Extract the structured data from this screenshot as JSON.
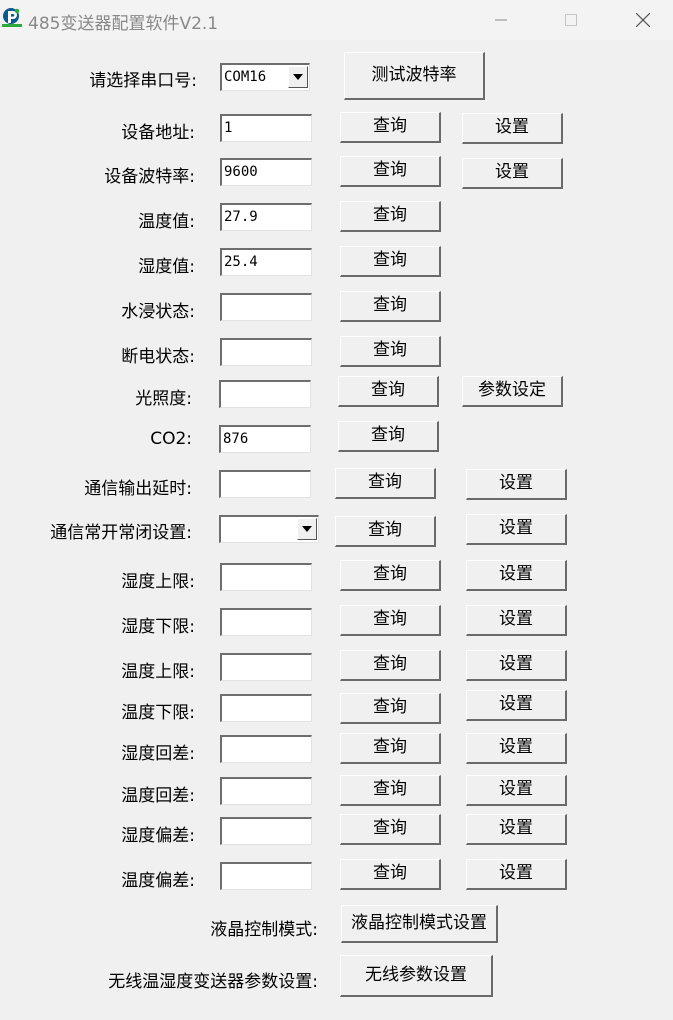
{
  "window": {
    "title": "485变送器配置软件V2.1",
    "icon": "app-logo-icon",
    "controls": [
      "minimize-icon",
      "maximize-icon",
      "close-icon"
    ]
  },
  "port": {
    "label": "请选择串口号:",
    "value": "COM16",
    "test_button": "测试波特率"
  },
  "rows": [
    {
      "label": "设备地址:",
      "value": "1",
      "query": "查询",
      "set": "设置"
    },
    {
      "label": "设备波特率:",
      "value": "9600",
      "query": "查询",
      "set": "设置"
    },
    {
      "label": "温度值:",
      "value": "27.9",
      "query": "查询"
    },
    {
      "label": "湿度值:",
      "value": "25.4",
      "query": "查询"
    },
    {
      "label": "水浸状态:",
      "value": "",
      "query": "查询"
    },
    {
      "label": "断电状态:",
      "value": "",
      "query": "查询"
    },
    {
      "label": "光照度:",
      "value": "",
      "query": "查询",
      "set": "参数设定"
    },
    {
      "label": "CO2:",
      "value": "876",
      "query": "查询"
    },
    {
      "label": "通信输出延时:",
      "value": "",
      "query": "查询",
      "set": "设置"
    },
    {
      "label": "通信常开常闭设置:",
      "value": "",
      "query": "查询",
      "set": "设置"
    },
    {
      "label": "湿度上限:",
      "value": "",
      "query": "查询",
      "set": "设置"
    },
    {
      "label": "湿度下限:",
      "value": "",
      "query": "查询",
      "set": "设置"
    },
    {
      "label": "温度上限:",
      "value": "",
      "query": "查询",
      "set": "设置"
    },
    {
      "label": "温度下限:",
      "value": "",
      "query": "查询",
      "set": "设置"
    },
    {
      "label": "湿度回差:",
      "value": "",
      "query": "查询",
      "set": "设置"
    },
    {
      "label": "温度回差:",
      "value": "",
      "query": "查询",
      "set": "设置"
    },
    {
      "label": "湿度偏差:",
      "value": "",
      "query": "查询",
      "set": "设置"
    },
    {
      "label": "温度偏差:",
      "value": "",
      "query": "查询",
      "set": "设置"
    }
  ],
  "lcd": {
    "label": "液晶控制模式:",
    "button": "液晶控制模式设置"
  },
  "wireless": {
    "label": "无线温湿度变送器参数设置:",
    "button": "无线参数设置"
  }
}
